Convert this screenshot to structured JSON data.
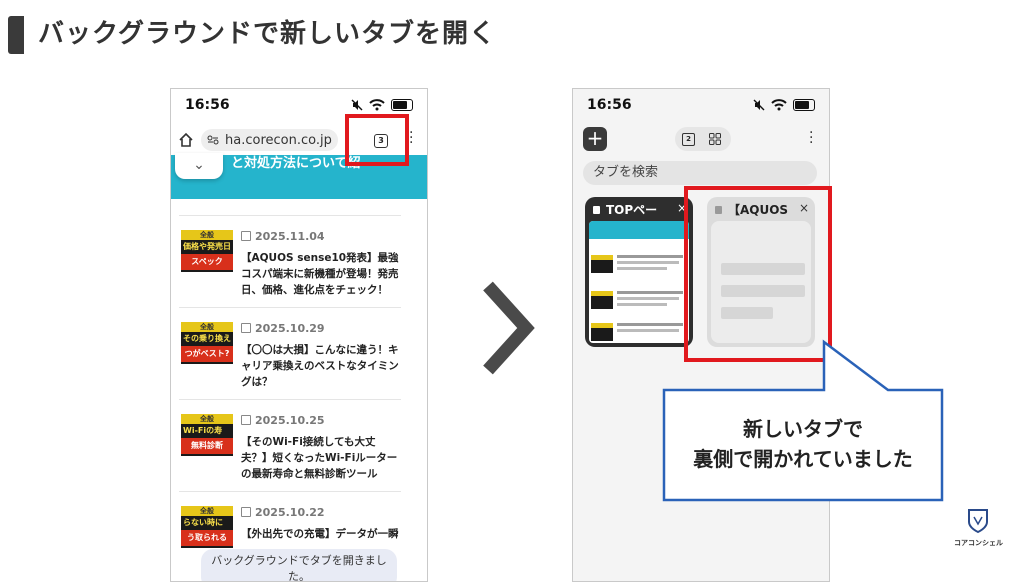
{
  "page": {
    "title": "バックグラウンドで新しいタブを開く"
  },
  "left_phone": {
    "time": "16:56",
    "url": "ha.corecon.co.jp",
    "tab_count": "3",
    "banner_text": "と対処方法について紹",
    "articles": [
      {
        "thumb_category": "全般",
        "thumb_title": "価格や発売日",
        "thumb_sub": "スペック",
        "date": "2025.11.04",
        "headline": "【AQUOS sense10発表】最強コスパ端末に新機種が登場！発売日、価格、進化点をチェック！"
      },
      {
        "thumb_category": "全般",
        "thumb_title": "その乗り換え",
        "thumb_sub": "つがベスト?",
        "date": "2025.10.29",
        "headline": "【〇〇は大損】こんなに違う！キャリア乗換えのベストなタイミングは？"
      },
      {
        "thumb_category": "全般",
        "thumb_title": "Wi-Fiの寿",
        "thumb_sub": "無料診断",
        "date": "2025.10.25",
        "headline": "【そのWi-Fi接続しても大丈夫？】短くなったWi-Fiルーターの最新寿命と無料診断ツール"
      },
      {
        "thumb_category": "全般",
        "thumb_title": "らない時に",
        "thumb_sub": "う取られる",
        "date": "2025.10.22",
        "headline": "【外出先での充電】データが一瞬"
      }
    ],
    "toast": "バックグラウンドでタブを開きました。"
  },
  "right_phone": {
    "time": "16:56",
    "tab_count": "2",
    "search_placeholder": "タブを検索",
    "tab1_title": "TOPペー",
    "tab2_title": "【AQUOS",
    "close_glyph": "×"
  },
  "callout": {
    "line1": "新しいタブで",
    "line2": "裏側で開かれていました"
  },
  "logo": {
    "label": "コアコンシェル"
  },
  "colors": {
    "accent_red": "#e1191e",
    "banner_cyan": "#25b4cc",
    "callout_blue": "#2a62b8",
    "dark": "#2e2e2e"
  }
}
